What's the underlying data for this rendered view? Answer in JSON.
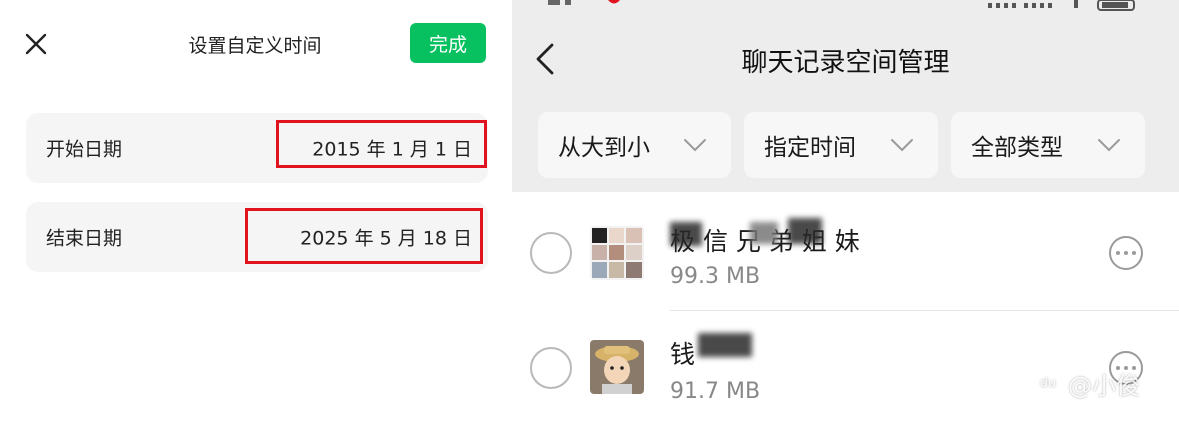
{
  "left": {
    "title": "设置自定义时间",
    "done_label": "完成",
    "rows": [
      {
        "label": "开始日期",
        "value": "2015 年 1 月 1 日"
      },
      {
        "label": "结束日期",
        "value": "2025 年 5 月 18 日"
      }
    ]
  },
  "right": {
    "title": "聊天记录空间管理",
    "filters": [
      {
        "label": "从大到小"
      },
      {
        "label": "指定时间"
      },
      {
        "label": "全部类型"
      }
    ],
    "chats": [
      {
        "name": "极 信 兄 弟 姐 妹",
        "size": "99.3 MB"
      },
      {
        "name": "钱",
        "size": "91.7 MB"
      }
    ]
  },
  "watermark": {
    "logo": "du",
    "text": "@小俊"
  },
  "colors": {
    "accent": "#07c160",
    "highlight": "#e0141e",
    "header_bg": "#ededed"
  }
}
